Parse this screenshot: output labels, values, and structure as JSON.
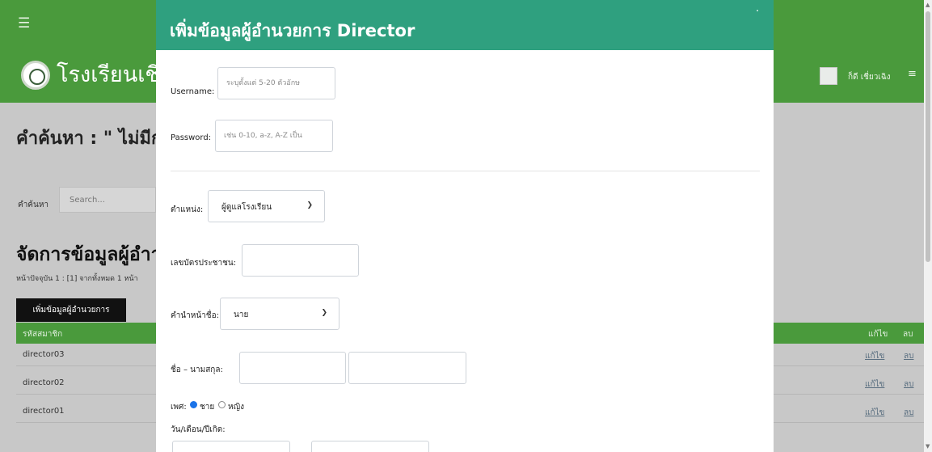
{
  "colors": {
    "topbar": "#4a9a3c",
    "modal_header": "#2fa07f",
    "overlay": "#c8c8c8"
  },
  "icons": {
    "menu": "hamburger-icon",
    "close": "close-icon",
    "select_arrow": "chevron-down-icon"
  },
  "header": {
    "school_name": "โรงเรียนเชี",
    "user_name": "ก็ดี เชี่ยวเฉิง",
    "menu_glyph": "≡"
  },
  "page": {
    "search_heading": "คำค้นหา : \" ไม่มีก",
    "search_label": "คำค้นหา",
    "search_placeholder": "Search...",
    "manage_heading": "จัดการข้อมูลผู้อำา",
    "page_info": "หน้าปัจจุบัน 1 : [1] จากทั้งหมด 1 หน้า",
    "add_button": "เพิ่มข้อมูลผู้อำนวยการ"
  },
  "table": {
    "col_id": "รหัสสมาชิก",
    "col_edit": "แก้ไข",
    "col_delete": "ลบ",
    "rows": [
      {
        "id": "director03",
        "edit": "แก้ไข",
        "delete": "ลบ"
      },
      {
        "id": "director02",
        "edit": "แก้ไข",
        "delete": "ลบ"
      },
      {
        "id": "director01",
        "edit": "แก้ไข",
        "delete": "ลบ"
      }
    ]
  },
  "modal": {
    "title": "เพิ่มข้อมูลผู้อำนวยการ Director",
    "close": "·",
    "username_label": "Username:",
    "username_placeholder": "ระบุตั้งแต่ 5-20 ตัวอักษ",
    "password_label": "Password:",
    "password_placeholder": "เช่น 0-10, a-z, A-Z เป็น",
    "position_label": "ตำแหน่ง:",
    "position_value": "ผู้ดูแลโรงเรียน",
    "id_card_label": "เลขบัตรประชาชน:",
    "prefix_label": "คำนำหน้าชื่อ:",
    "prefix_value": "นาย",
    "name_label": "ชื่อ – นามสกุล:",
    "gender_label": "เพศ:",
    "gender_male": "ชาย",
    "gender_female": "หญิง",
    "gender_selected": "male",
    "dob_label": "วัน/เดือน/ปีเกิด:"
  }
}
